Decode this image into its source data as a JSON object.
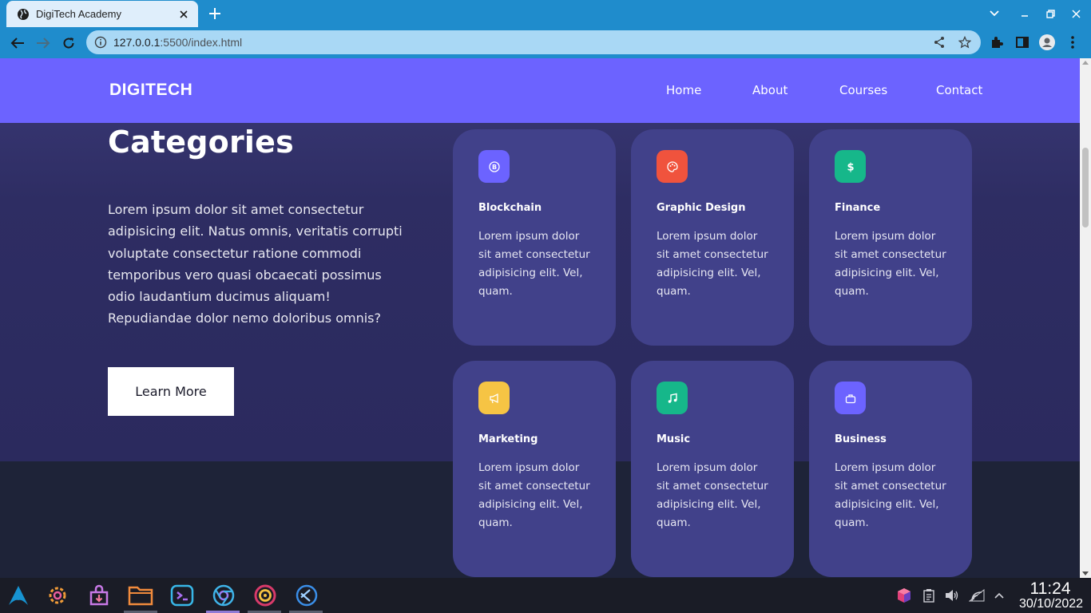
{
  "browser": {
    "tab_title": "DigiTech Academy",
    "url_host": "127.0.0.1",
    "url_path": ":5500/index.html"
  },
  "site": {
    "brand": "DIGITECH",
    "nav": [
      "Home",
      "About",
      "Courses",
      "Contact"
    ],
    "categories_title": "Categories",
    "categories_desc": "Lorem ipsum dolor sit amet consectetur adipisicing elit. Natus omnis, veritatis corrupti voluptate consectetur ratione commodi temporibus vero quasi obcaecati possimus odio laudantium ducimus aliquam! Repudiandae dolor nemo doloribus omnis?",
    "learn_more": "Learn More",
    "cards": [
      {
        "title": "Blockchain",
        "text": "Lorem ipsum dolor sit amet consectetur adipisicing elit. Vel, quam.",
        "icon": "bitcoin-icon",
        "color": "#6c63ff"
      },
      {
        "title": "Graphic Design",
        "text": "Lorem ipsum dolor sit amet consectetur adipisicing elit. Vel, quam.",
        "icon": "palette-icon",
        "color": "#f0533d"
      },
      {
        "title": "Finance",
        "text": "Lorem ipsum dolor sit amet consectetur adipisicing elit. Vel, quam.",
        "icon": "dollar-icon",
        "color": "#16b78a"
      },
      {
        "title": "Marketing",
        "text": "Lorem ipsum dolor sit amet consectetur adipisicing elit. Vel, quam.",
        "icon": "megaphone-icon",
        "color": "#f6c444"
      },
      {
        "title": "Music",
        "text": "Lorem ipsum dolor sit amet consectetur adipisicing elit. Vel, quam.",
        "icon": "music-note-icon",
        "color": "#16b78a"
      },
      {
        "title": "Business",
        "text": "Lorem ipsum dolor sit amet consectetur adipisicing elit. Vel, quam.",
        "icon": "briefcase-icon",
        "color": "#6c63ff"
      }
    ]
  },
  "taskbar": {
    "time": "11:24",
    "date": "30/10/2022"
  },
  "colors": {
    "chrome": "#1f8ccc",
    "navbar": "#6c63ff",
    "card": "#41418a"
  }
}
